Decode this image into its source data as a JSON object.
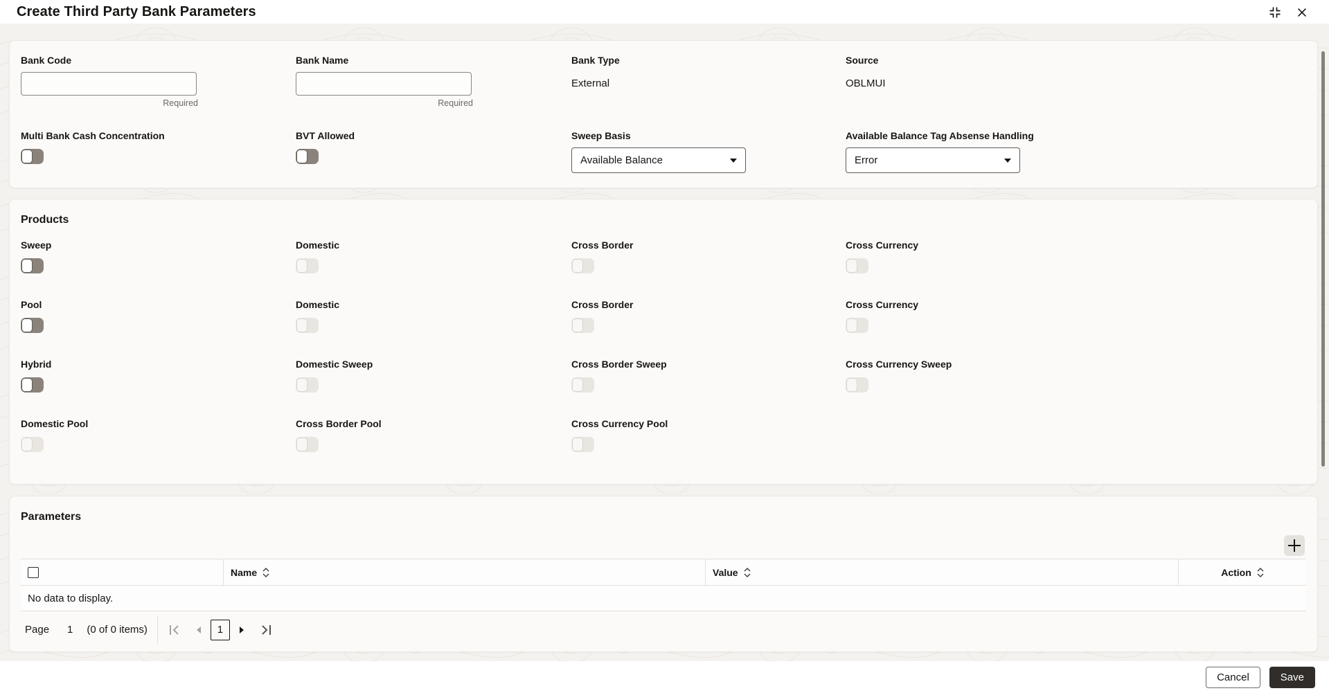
{
  "window": {
    "title": "Create Third Party Bank Parameters",
    "controls": {
      "collapse_icon": "collapse-icon",
      "close_icon": "close-icon"
    }
  },
  "bank_details": {
    "bank_code": {
      "label": "Bank Code",
      "value": "",
      "hint": "Required"
    },
    "bank_name": {
      "label": "Bank Name",
      "value": "",
      "hint": "Required"
    },
    "bank_type": {
      "label": "Bank Type",
      "value": "External"
    },
    "source": {
      "label": "Source",
      "value": "OBLMUI"
    },
    "multi_bank_cash_concentration": {
      "label": "Multi Bank Cash Concentration",
      "state": "off"
    },
    "bvt_allowed": {
      "label": "BVT Allowed",
      "state": "off"
    },
    "sweep_basis": {
      "label": "Sweep Basis",
      "value": "Available Balance",
      "icon": "chevron-down-icon"
    },
    "abs_handling": {
      "label": "Available Balance Tag Absense Handling",
      "value": "Error",
      "icon": "chevron-down-icon"
    }
  },
  "products": {
    "title": "Products",
    "rows": [
      {
        "cells": [
          {
            "label": "Sweep",
            "state": "off",
            "disabled": false
          },
          {
            "label": "Domestic",
            "state": "off",
            "disabled": true
          },
          {
            "label": "Cross Border",
            "state": "off",
            "disabled": true
          },
          {
            "label": "Cross Currency",
            "state": "off",
            "disabled": true
          }
        ]
      },
      {
        "cells": [
          {
            "label": "Pool",
            "state": "off",
            "disabled": false
          },
          {
            "label": "Domestic",
            "state": "off",
            "disabled": true
          },
          {
            "label": "Cross Border",
            "state": "off",
            "disabled": true
          },
          {
            "label": "Cross Currency",
            "state": "off",
            "disabled": true
          }
        ]
      },
      {
        "cells": [
          {
            "label": "Hybrid",
            "state": "off",
            "disabled": false
          },
          {
            "label": "Domestic Sweep",
            "state": "off",
            "disabled": true
          },
          {
            "label": "Cross Border Sweep",
            "state": "off",
            "disabled": true
          },
          {
            "label": "Cross Currency Sweep",
            "state": "off",
            "disabled": true
          }
        ]
      },
      {
        "cells": [
          {
            "label": "Domestic Pool",
            "state": "off",
            "disabled": true
          },
          {
            "label": "Cross Border Pool",
            "state": "off",
            "disabled": true
          },
          {
            "label": "Cross Currency Pool",
            "state": "off",
            "disabled": true
          }
        ]
      }
    ]
  },
  "parameters": {
    "title": "Parameters",
    "add_button_icon": "plus-icon",
    "table": {
      "columns": {
        "name": "Name",
        "value": "Value",
        "action": "Action"
      },
      "sort_icon": "sort-icon",
      "empty_message": "No data to display."
    },
    "pagination": {
      "page_label": "Page",
      "page_value": "1",
      "items_summary": "(0 of 0 items)",
      "current_page": "1",
      "icons": [
        "first-page-icon",
        "previous-page-icon",
        "next-page-icon",
        "last-page-icon"
      ]
    }
  },
  "footer": {
    "cancel_label": "Cancel",
    "save_label": "Save"
  },
  "colors": {
    "text": "#161513",
    "panel_bg": "#fbfaf8",
    "page_bg": "#f4f2ef",
    "primary_button_bg": "#312d2a",
    "toggle_track_enabled": "#8b837b",
    "toggle_track_disabled": "#e9e6e2",
    "border": "#e2dfdb"
  }
}
